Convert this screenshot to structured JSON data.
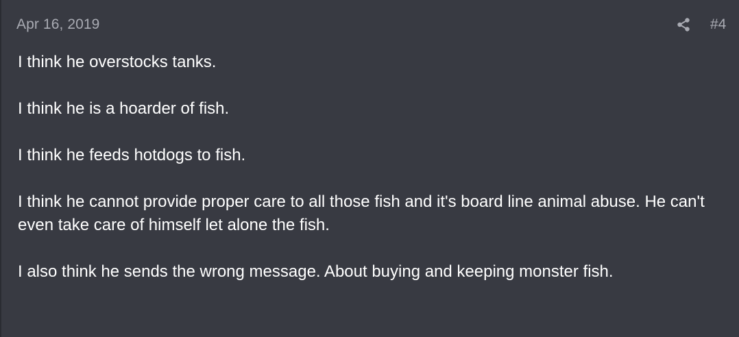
{
  "post": {
    "date": "Apr 16, 2019",
    "share_icon": "share-icon",
    "number": "#4",
    "paragraphs": [
      "I think he overstocks tanks.",
      "I think he is a hoarder of fish.",
      "I think he feeds hotdogs to fish.",
      "I think he cannot provide proper care to all those fish and it's board line animal abuse. He can't even take care of himself let alone the fish.",
      "I also think he sends the wrong message. About buying and keeping monster fish."
    ]
  },
  "colors": {
    "background": "#383a42",
    "meta_text": "#a9abb3",
    "body_text": "#ffffff"
  }
}
